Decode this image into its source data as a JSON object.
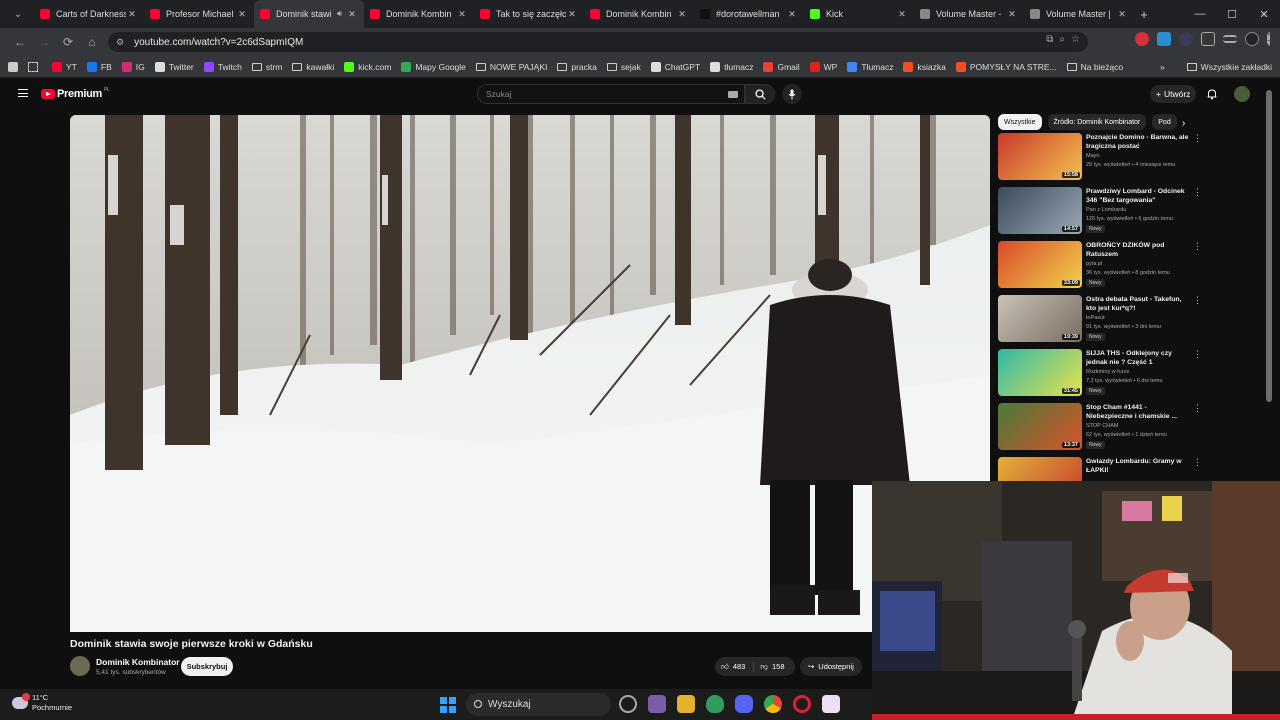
{
  "browser": {
    "tabs": [
      {
        "title": "Carts of Darkness",
        "favicon_color": "#ff0033",
        "active": false
      },
      {
        "title": "Profesor Michael",
        "favicon_color": "#ff0033",
        "active": false
      },
      {
        "title": "Dominik stawi",
        "favicon_color": "#ff0033",
        "active": true,
        "audio": true
      },
      {
        "title": "Dominik Kombin",
        "favicon_color": "#ff0033",
        "active": false
      },
      {
        "title": "Tak to się zaczęło",
        "favicon_color": "#ff0033",
        "active": false
      },
      {
        "title": "Dominik Kombin",
        "favicon_color": "#ff0033",
        "active": false
      },
      {
        "title": "#dorotawellman",
        "favicon_color": "#111111",
        "active": false
      },
      {
        "title": "Kick",
        "favicon_color": "#53fc18",
        "active": false
      },
      {
        "title": "Volume Master -",
        "favicon_color": "#888888",
        "active": false
      },
      {
        "title": "Volume Master |",
        "favicon_color": "#888888",
        "active": false
      }
    ],
    "close_glyph": "✕",
    "new_tab_glyph": "+",
    "url": "youtube.com/watch?v=2c6dSapmIQM",
    "bookmarks": [
      {
        "label": "YT",
        "icon": "youtube-icon",
        "color": "#ff0033"
      },
      {
        "label": "FB",
        "icon": "facebook-icon",
        "color": "#1877f2"
      },
      {
        "label": "IG",
        "icon": "instagram-icon",
        "color": "#d62976"
      },
      {
        "label": "Twitter",
        "icon": "x-icon",
        "color": "#dddddd"
      },
      {
        "label": "Twitch",
        "icon": "twitch-icon",
        "color": "#9146ff"
      },
      {
        "label": "strm",
        "icon": "folder-icon",
        "color": ""
      },
      {
        "label": "kawałki",
        "icon": "folder-icon",
        "color": ""
      },
      {
        "label": "kick.com",
        "icon": "kick-icon",
        "color": "#53fc18"
      },
      {
        "label": "Mapy Google",
        "icon": "maps-icon",
        "color": "#34a853"
      },
      {
        "label": "NOWE PAJĄKI",
        "icon": "folder-icon",
        "color": ""
      },
      {
        "label": "pracka",
        "icon": "folder-icon",
        "color": ""
      },
      {
        "label": "sejak",
        "icon": "folder-icon",
        "color": ""
      },
      {
        "label": "ChatGPT",
        "icon": "chatgpt-icon",
        "color": "#dddddd"
      },
      {
        "label": "tłumacz",
        "icon": "translate-icon",
        "color": "#dddddd"
      },
      {
        "label": "Gmail",
        "icon": "gmail-icon",
        "color": "#ea4335"
      },
      {
        "label": "WP",
        "icon": "wp-icon",
        "color": "#e2231a"
      },
      {
        "label": "Tłumacz",
        "icon": "translate-icon",
        "color": "#4285f4"
      },
      {
        "label": "ksiazka",
        "icon": "windows-icon",
        "color": "#f25022"
      },
      {
        "label": "POMYSŁY NA STRE...",
        "icon": "windows-icon",
        "color": "#f25022"
      },
      {
        "label": "Na bieżąco",
        "icon": "folder-icon",
        "color": ""
      }
    ],
    "all_bookmarks": "Wszystkie zakładki"
  },
  "youtube": {
    "logo_text": "Premium",
    "logo_sup": "PL",
    "search_placeholder": "Szukaj",
    "create_label": "Utwórz",
    "video": {
      "title": "Dominik stawia swoje pierwsze kroki w Gdańsku",
      "channel": "Dominik Kombinator",
      "subscribers": "5,41 tys. subskrybentów",
      "subscribe_label": "Subskrybuj",
      "likes": "483",
      "dislikes": "158",
      "share_label": "Udostępnij"
    },
    "chips": [
      "Wszystkie",
      "Źródło: Dominik Kombinator",
      "Pod"
    ],
    "recommendations": [
      {
        "title": "Poznajcie Domino - Barwna, ale tragiczna postać",
        "channel": "Mayo",
        "meta": "29 tys. wyświetleń • 4 miesiące temu",
        "duration": "15:58",
        "new": false,
        "colors": [
          "#c8392b",
          "#f2c14e"
        ]
      },
      {
        "title": "Prawdziwy Lombard - Odcinek 346 \"Bez targowania\"",
        "channel": "Pan z Lombardu",
        "meta": "126 tys. wyświetleń • 6 godzin temu",
        "duration": "14:57",
        "new": true,
        "colors": [
          "#3b4a5c",
          "#9aa8b5"
        ]
      },
      {
        "title": "OBROŃCY DZIKÓW pod Ratuszem",
        "channel": "pyta.pl",
        "meta": "36 tys. wyświetleń • 8 godzin temu",
        "duration": "33:09",
        "new": true,
        "colors": [
          "#d94a2a",
          "#f0d24a"
        ]
      },
      {
        "title": "Ostra debata Pasut - Takefun, kto jest kur*q?!",
        "channel": "toPasut",
        "meta": "91 tys. wyświetleń • 3 dni temu",
        "duration": "19:39",
        "new": true,
        "colors": [
          "#c9c2b8",
          "#7a6d60"
        ]
      },
      {
        "title": "SIJJA THS - Odklejony czy jednak nie ? Część 1",
        "channel": "Rozkminy w furze",
        "meta": "7,2 tys. wyświetleń • 6 dni temu",
        "duration": "31:45",
        "new": true,
        "colors": [
          "#2fb8a8",
          "#e8e24a"
        ]
      },
      {
        "title": "Stop Cham #1441 - Niebezpieczne i chamskie ...",
        "channel": "STOP CHAM",
        "meta": "62 tys. wyświetleń • 1 dzień temu",
        "duration": "13:37",
        "new": true,
        "colors": [
          "#4a7a3a",
          "#d9532a"
        ]
      },
      {
        "title": "Gwiazdy Lombardu: Gramy w ŁAPKI!",
        "channel": "",
        "meta": "",
        "duration": "",
        "new": false,
        "colors": [
          "#e0b23a",
          "#c8392b"
        ]
      }
    ],
    "new_badge": "Nowy",
    "menu_glyph": "⋮"
  },
  "taskbar": {
    "temperature": "11°C",
    "weather": "Pochmurnie",
    "search_label": "Wyszukaj"
  }
}
